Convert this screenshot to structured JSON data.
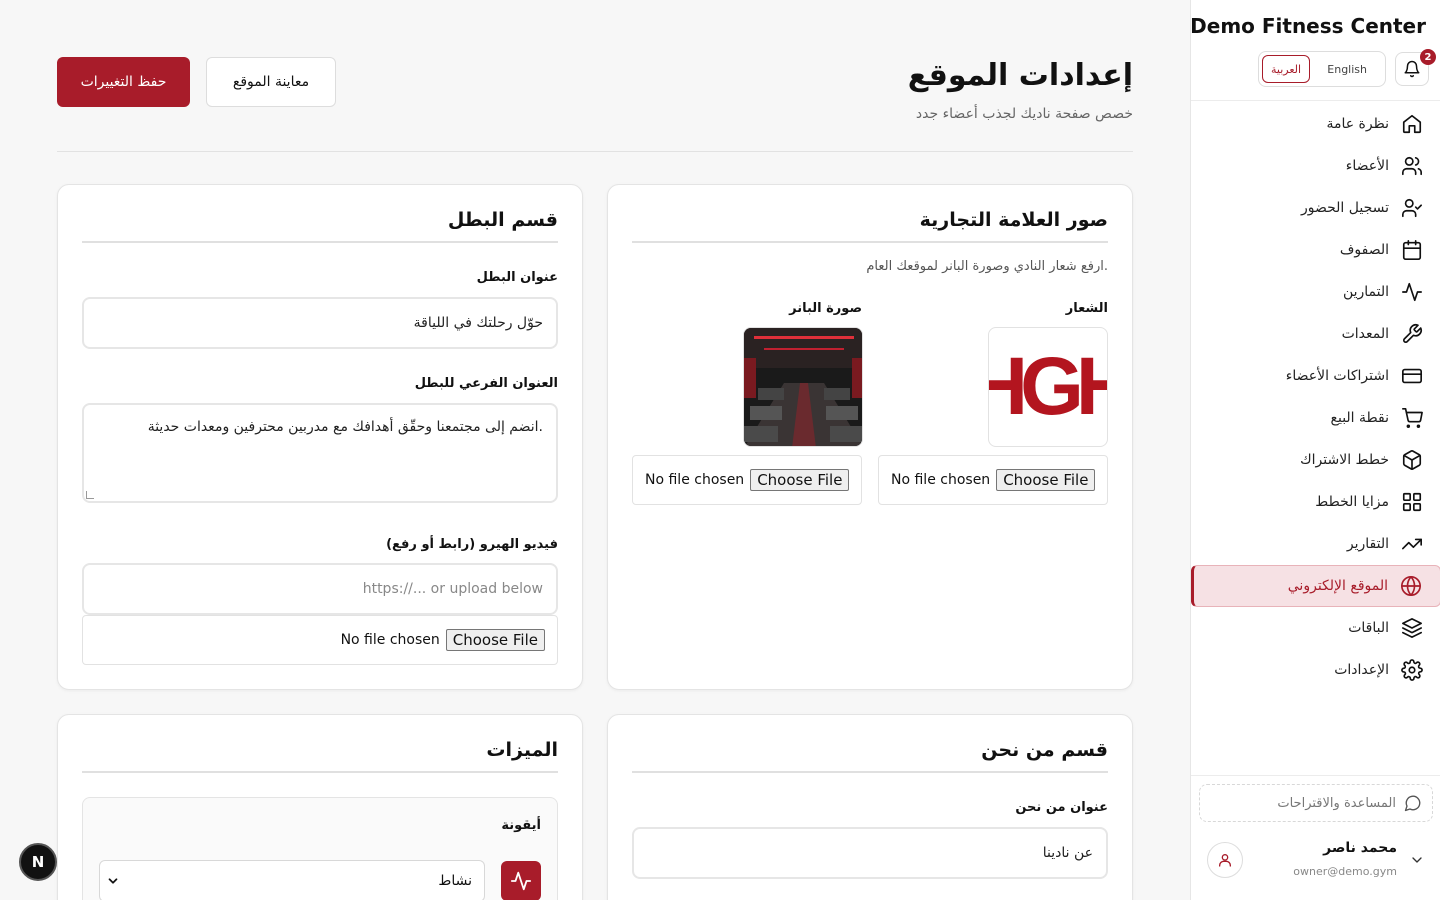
{
  "brand": "Demo Fitness Center",
  "notifications": {
    "count": "2"
  },
  "language": {
    "english": "English",
    "arabic": "العربية"
  },
  "nav": [
    {
      "label": "نظرة عامة",
      "icon": "home-icon"
    },
    {
      "label": "الأعضاء",
      "icon": "users-icon"
    },
    {
      "label": "تسجيل الحضور",
      "icon": "user-check-icon"
    },
    {
      "label": "الصفوف",
      "icon": "calendar-icon"
    },
    {
      "label": "التمارين",
      "icon": "activity-icon"
    },
    {
      "label": "المعدات",
      "icon": "wrench-icon"
    },
    {
      "label": "اشتراكات الأعضاء",
      "icon": "credit-card-icon"
    },
    {
      "label": "نقطة البيع",
      "icon": "cart-icon"
    },
    {
      "label": "خطط الاشتراك",
      "icon": "package-icon"
    },
    {
      "label": "مزايا الخطط",
      "icon": "grid-icon"
    },
    {
      "label": "التقارير",
      "icon": "trending-up-icon"
    },
    {
      "label": "الموقع الإلكتروني",
      "icon": "globe-icon",
      "active": true
    },
    {
      "label": "الباقات",
      "icon": "layers-icon"
    },
    {
      "label": "الإعدادات",
      "icon": "gear-icon"
    }
  ],
  "help": "المساعدة والاقتراحات",
  "user": {
    "name": "محمد ناصر",
    "email": "owner@demo.gym"
  },
  "header": {
    "title": "إعدادات الموقع",
    "subtitle": "خصص صفحة ناديك لجذب أعضاء جدد",
    "save": "حفظ التغييرات",
    "preview": "معاينة الموقع"
  },
  "brand_images": {
    "title": "صور العلامة التجارية",
    "description": "ارفع شعار النادي وصورة البانر لموقعك العام.",
    "logo_label": "الشعار",
    "logo_text": "HGH",
    "banner_label": "صورة البانر",
    "file_none": "No file chosen",
    "file_button": "Choose File"
  },
  "hero": {
    "title": "قسم البطل",
    "heading_label": "عنوان البطل",
    "heading_value": "حوّل رحلتك في اللياقة",
    "subtitle_label": "العنوان الفرعي للبطل",
    "subtitle_value": "انضم إلى مجتمعنا وحقّق أهدافك مع مدربين محترفين ومعدات حديثة.",
    "video_label": "فيديو الهيرو (رابط أو رفع)",
    "video_placeholder": "https://... or upload below",
    "file_none": "No file chosen",
    "file_button": "Choose File"
  },
  "about": {
    "title": "قسم من نحن",
    "heading_label": "عنوان من نحن",
    "heading_value": "عن نادينا"
  },
  "features": {
    "title": "الميزات",
    "icon_label": "أيقونة",
    "icon_value": "نشاط"
  },
  "colors": {
    "accent": "#a81c2a"
  }
}
